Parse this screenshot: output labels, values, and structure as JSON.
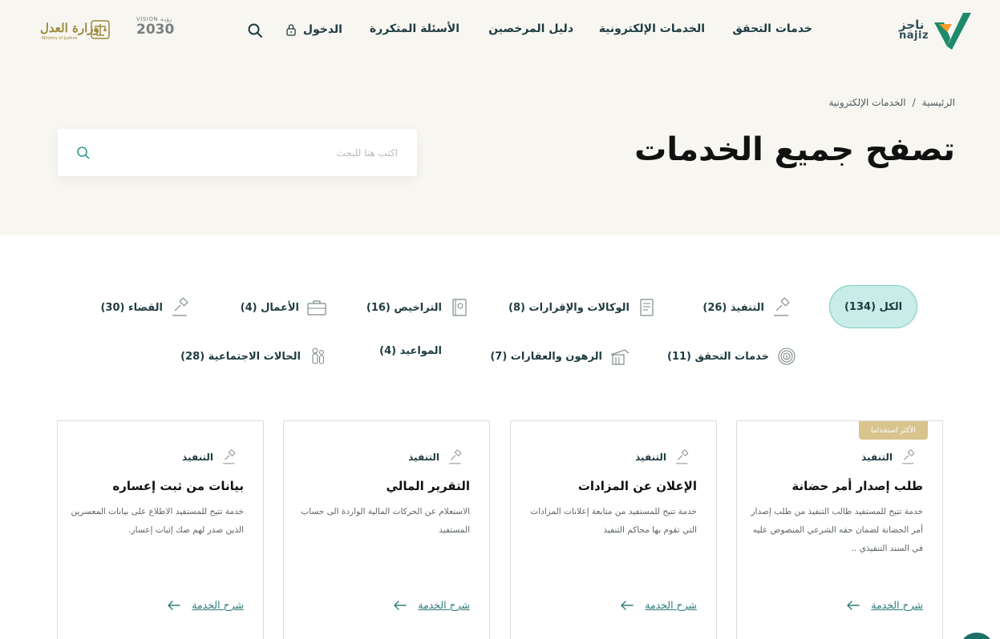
{
  "header": {
    "logo_text_ar": "ناجز",
    "logo_text_en": "najiz",
    "nav": {
      "verification": "خدمات التحقق",
      "eservices": "الخدمات الإلكترونية",
      "licensees": "دليل المرخصين",
      "faq": "الأسئلة المتكررة"
    },
    "login_label": "الدخول",
    "vision_top": "VISION رؤيـة",
    "vision_year": "2030",
    "moj_ar": "وزارة العدل",
    "moj_en": "Ministry of Justice"
  },
  "hero": {
    "breadcrumb": [
      "الرئيسية",
      "/",
      "الخدمات الإلكترونية"
    ],
    "title": "تصفح جميع الخدمات",
    "search_placeholder": "اكتب هنا للبحث"
  },
  "filters": {
    "all": "الكل (134)",
    "execution": "التنفيذ (26)",
    "agencies": "الوكالات والإقرارات (8)",
    "licenses": "التراخيص (16)",
    "business": "الأعمال (4)",
    "judiciary": "القضاء (30)",
    "verification": "خدمات التحقق (11)",
    "mortgages": "الرهون والعقارات (7)",
    "appointments": "المواعيد (4)",
    "social": "الحالات الاجتماعية (28)"
  },
  "cards": [
    {
      "badge": "الأكثر استخداما",
      "category": "التنفيذ",
      "title": "طلب إصدار أمر حضانة",
      "description": "خدمة تتيح للمستفيد طالب التنفيذ من طلب إصدار أمر الحضانة لضمان حقه الشرعي المنصوص عليه في السند التنفيذي ..",
      "link": "شرح الخدمة"
    },
    {
      "category": "التنفيذ",
      "title": "الإعلان عن المزادات",
      "description": "خدمة تتيح للمستفيد من متابعة إعلانات المزادات التي تقوم بها محاكم التنفيذ",
      "link": "شرح الخدمة"
    },
    {
      "category": "التنفيذ",
      "title": "التقرير المالي",
      "description": "الاستعلام عن الحركات المالية الواردة الى حساب المستفيد",
      "link": "شرح الخدمة"
    },
    {
      "category": "التنفيذ",
      "title": "بيانات من ثبت إعساره",
      "description": "خدمة تتيح للمستفيد الاطلاع على بيانات المعسرين الذين صدر لهم صك إثبات إعسار.",
      "link": "شرح الخدمة"
    }
  ],
  "colors": {
    "brand_green": "#1d6f67",
    "accent_teal": "#2d7c7a",
    "hero_bg": "#f7f6f1",
    "chip_active_bg": "#c8ece8",
    "badge_gold": "#d9c48e"
  },
  "icons": {
    "search": "search-icon",
    "lock": "lock-icon",
    "gavel": "gavel-icon",
    "document": "document-icon",
    "license": "license-book-icon",
    "briefcase": "briefcase-icon",
    "fingerprint": "fingerprint-icon",
    "building": "building-icon",
    "family": "family-icon",
    "arrow_left": "arrow-left-icon"
  }
}
